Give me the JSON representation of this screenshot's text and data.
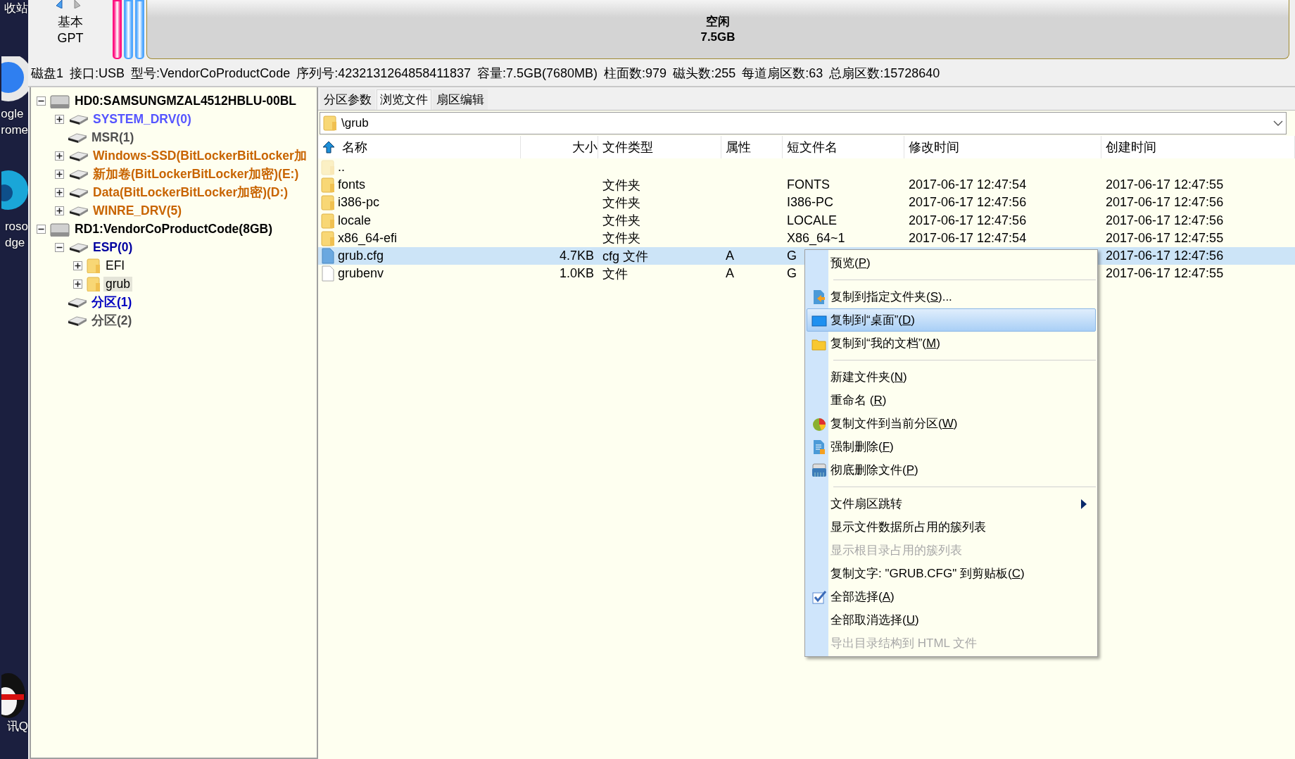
{
  "desktop": {
    "icons": [
      {
        "kind": "none",
        "lines": [
          "收站"
        ]
      },
      {
        "kind": "app",
        "lines": [
          "ogle",
          "rome"
        ]
      },
      {
        "kind": "app",
        "lines": [
          "roso",
          "dge"
        ]
      },
      {
        "kind": "app",
        "lines": [
          "讯Q"
        ]
      }
    ]
  },
  "disk_map": {
    "style": [
      "基本",
      "GPT"
    ],
    "partitions": [
      {
        "color": "#ff1080"
      },
      {
        "color": "#4da6ff"
      },
      {
        "color": "#4da6ff"
      }
    ],
    "free": {
      "label": "空闲",
      "size": "7.5GB"
    }
  },
  "disk_info": [
    "磁盘1",
    "接口:USB",
    "型号:VendorCoProductCode",
    "序列号:4232131264858411837",
    "容量:7.5GB(7680MB)",
    "柱面数:979",
    "磁头数:255",
    "每道扇区数:63",
    "总扇区数:15728640"
  ],
  "tree": [
    {
      "label": "HD0:SAMSUNGMZAL4512HBLU-00BL",
      "kind": "disk",
      "expandable": true,
      "expanded": true,
      "color": "#000000",
      "selected": false,
      "children": [
        {
          "label": "SYSTEM_DRV(0)",
          "kind": "partition",
          "expandable": true,
          "expanded": false,
          "color": "#5555ff",
          "selected": false
        },
        {
          "label": "MSR(1)",
          "kind": "partition",
          "expandable": false,
          "color": "#505050",
          "selected": false
        },
        {
          "label": "Windows-SSD(BitLockerBitLocker加",
          "kind": "partition",
          "expandable": true,
          "expanded": false,
          "color": "#c86400",
          "selected": false
        },
        {
          "label": "新加卷(BitLockerBitLocker加密)(E:)",
          "kind": "partition",
          "expandable": true,
          "expanded": false,
          "color": "#c86400",
          "selected": false
        },
        {
          "label": "Data(BitLockerBitLocker加密)(D:)",
          "kind": "partition",
          "expandable": true,
          "expanded": false,
          "color": "#c86400",
          "selected": false
        },
        {
          "label": "WINRE_DRV(5)",
          "kind": "partition",
          "expandable": true,
          "expanded": false,
          "color": "#c86400",
          "selected": false
        }
      ]
    },
    {
      "label": "RD1:VendorCoProductCode(8GB)",
      "kind": "disk",
      "expandable": true,
      "expanded": true,
      "color": "#000000",
      "selected": false,
      "children": [
        {
          "label": "ESP(0)",
          "kind": "partition",
          "expandable": true,
          "expanded": true,
          "color": "#0000a0",
          "selected": false,
          "children": [
            {
              "label": "EFI",
              "kind": "folder",
              "expandable": true,
              "expanded": false,
              "color": "#000000",
              "selected": false
            },
            {
              "label": "grub",
              "kind": "folder",
              "expandable": true,
              "expanded": false,
              "color": "#000000",
              "selected": true
            }
          ]
        },
        {
          "label": "分区(1)",
          "kind": "partition",
          "expandable": false,
          "color": "#0000c0",
          "selected": false
        },
        {
          "label": "分区(2)",
          "kind": "partition",
          "expandable": false,
          "color": "#505050",
          "selected": false
        }
      ]
    }
  ],
  "tabs": [
    {
      "label": "分区参数",
      "selected": false
    },
    {
      "label": "浏览文件",
      "selected": true
    },
    {
      "label": "扇区编辑",
      "selected": false
    }
  ],
  "path": {
    "value": "\\grub"
  },
  "columns": [
    "名称",
    "大小",
    "文件类型",
    "属性",
    "短文件名",
    "修改时间",
    "创建时间"
  ],
  "files": [
    {
      "kind": "parent",
      "name": "..",
      "selected": false
    },
    {
      "kind": "folder",
      "name": "fonts",
      "type": "文件夹",
      "short": "FONTS",
      "modified": "2017-06-17 12:47:54",
      "created": "2017-06-17 12:47:55",
      "selected": false
    },
    {
      "kind": "folder",
      "name": "i386-pc",
      "type": "文件夹",
      "short": "I386-PC",
      "modified": "2017-06-17 12:47:56",
      "created": "2017-06-17 12:47:56",
      "selected": false
    },
    {
      "kind": "folder",
      "name": "locale",
      "type": "文件夹",
      "short": "LOCALE",
      "modified": "2017-06-17 12:47:56",
      "created": "2017-06-17 12:47:56",
      "selected": false
    },
    {
      "kind": "folder",
      "name": "x86_64-efi",
      "type": "文件夹",
      "short": "X86_64~1",
      "modified": "2017-06-17 12:47:54",
      "created": "2017-06-17 12:47:55",
      "selected": false
    },
    {
      "kind": "config",
      "name": "grub.cfg",
      "size": "4.7KB",
      "type": "cfg 文件",
      "attr": "A",
      "short": "G",
      "created": "2017-06-17 12:47:56",
      "selected": true
    },
    {
      "kind": "file",
      "name": "grubenv",
      "size": "1.0KB",
      "type": "文件",
      "attr": "A",
      "short": "G",
      "created": "2017-06-17 12:47:55",
      "selected": false
    }
  ],
  "menu": {
    "items": [
      {
        "kind": "item",
        "label": "预览(",
        "key": "P",
        "tail": ")",
        "selected": false,
        "disabled": false,
        "submenu": false
      },
      {
        "kind": "separator"
      },
      {
        "kind": "item",
        "label": "复制到指定文件夹(",
        "key": "S",
        "tail": ")...",
        "selected": false,
        "disabled": false,
        "submenu": false
      },
      {
        "kind": "item",
        "label": "复制到“桌面”(",
        "key": "D",
        "tail": ")",
        "selected": true,
        "disabled": false,
        "submenu": false
      },
      {
        "kind": "item",
        "label": "复制到“我的文档”(",
        "key": "M",
        "tail": ")",
        "selected": false,
        "disabled": false,
        "submenu": false
      },
      {
        "kind": "separator"
      },
      {
        "kind": "item",
        "label": "新建文件夹(",
        "key": "N",
        "tail": ")",
        "selected": false,
        "disabled": false,
        "submenu": false
      },
      {
        "kind": "item",
        "label": "重命名 (",
        "key": "R",
        "tail": ")",
        "selected": false,
        "disabled": false,
        "submenu": false
      },
      {
        "kind": "item",
        "label": "复制文件到当前分区(",
        "key": "W",
        "tail": ")",
        "selected": false,
        "disabled": false,
        "submenu": false
      },
      {
        "kind": "item",
        "label": "强制删除(",
        "key": "F",
        "tail": ")",
        "selected": false,
        "disabled": false,
        "submenu": false
      },
      {
        "kind": "item",
        "label": "彻底删除文件(",
        "key": "P",
        "tail": ")",
        "selected": false,
        "disabled": false,
        "submenu": false
      },
      {
        "kind": "separator"
      },
      {
        "kind": "item",
        "label": "文件扇区跳转",
        "selected": false,
        "disabled": false,
        "submenu": true
      },
      {
        "kind": "item",
        "label": "显示文件数据所占用的簇列表",
        "selected": false,
        "disabled": false,
        "submenu": false
      },
      {
        "kind": "item",
        "label": "显示根目录占用的簇列表",
        "selected": false,
        "disabled": true,
        "submenu": false
      },
      {
        "kind": "item",
        "label": "复制文字: \"GRUB.CFG\" 到剪贴板(",
        "key": "C",
        "tail": ")",
        "selected": false,
        "disabled": false,
        "submenu": false
      },
      {
        "kind": "item",
        "label": "全部选择(",
        "key": "A",
        "tail": ")",
        "selected": false,
        "disabled": false,
        "submenu": false
      },
      {
        "kind": "item",
        "label": "全部取消选择(",
        "key": "U",
        "tail": ")",
        "selected": false,
        "disabled": false,
        "submenu": false
      },
      {
        "kind": "item",
        "label": "导出目录结构到 HTML 文件",
        "selected": false,
        "disabled": true,
        "submenu": false
      }
    ]
  }
}
